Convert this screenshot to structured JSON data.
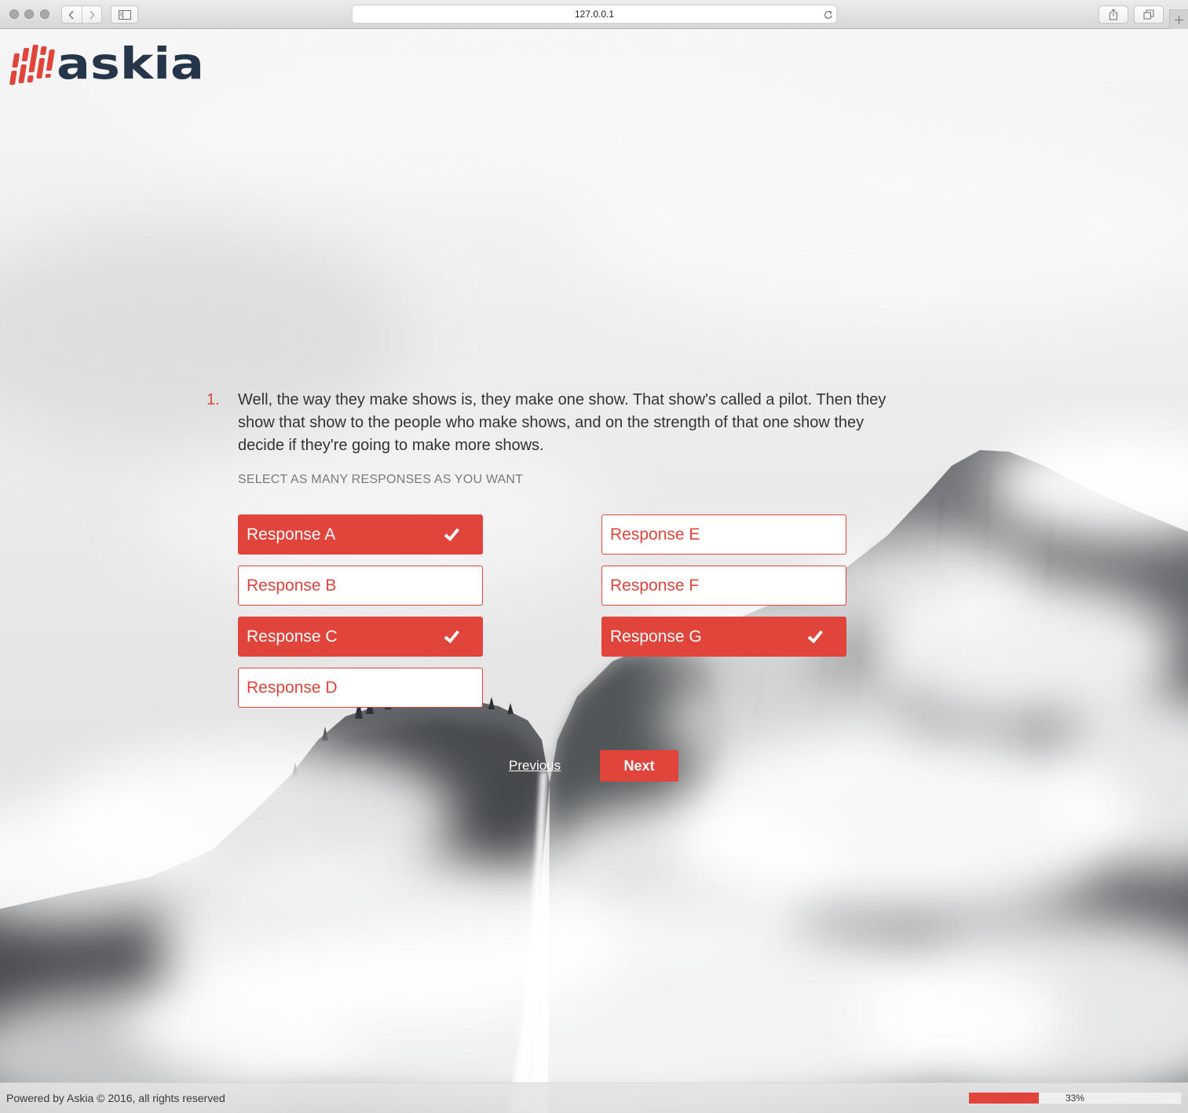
{
  "browser": {
    "url": "127.0.0.1",
    "toolbar_icons": [
      "chevron-left-icon",
      "chevron-right-icon",
      "sidebar-icon",
      "reload-icon",
      "share-icon",
      "tabs-icon",
      "plus-icon"
    ]
  },
  "brand": {
    "logo_text": "askia",
    "colors": {
      "primary": "#e0443b",
      "logo_text": "#26364a",
      "text": "#333333",
      "instruction": "#7a7a7a"
    }
  },
  "question": {
    "number": "1.",
    "lines": [
      "Well, the way they make shows is, they make one show. That show's called a pilot. Then they",
      "show that show to the people who make shows, and on the strength of that one show they",
      "decide if they're going to make more shows."
    ],
    "instruction": "SELECT AS MANY RESPONSES AS YOU WANT"
  },
  "responses": {
    "columns": [
      [
        {
          "label": "Response A",
          "selected": true
        },
        {
          "label": "Response B",
          "selected": false
        },
        {
          "label": "Response C",
          "selected": true
        },
        {
          "label": "Response D",
          "selected": false
        }
      ],
      [
        {
          "label": "Response E",
          "selected": false
        },
        {
          "label": "Response F",
          "selected": false
        },
        {
          "label": "Response G",
          "selected": true
        }
      ]
    ]
  },
  "navigation": {
    "previous_label": "Previous",
    "next_label": "Next"
  },
  "footer": {
    "powered_by": "Powered by Askia © 2016, all rights reserved",
    "progress": {
      "percent": 33,
      "label": "33%"
    }
  }
}
